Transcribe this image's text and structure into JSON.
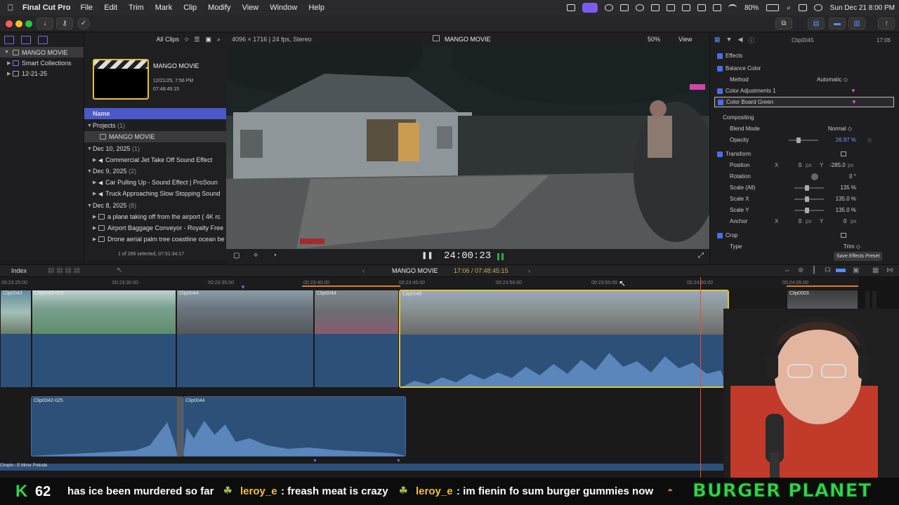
{
  "menubar": {
    "app_name": "Final Cut Pro",
    "items": [
      "File",
      "Edit",
      "Trim",
      "Mark",
      "Clip",
      "Modify",
      "View",
      "Window",
      "Help"
    ],
    "battery": "80%",
    "datetime": "Sun Dec 21  8:00 PM"
  },
  "library": {
    "items": [
      {
        "label": "MANGO MOVIE",
        "icon": "library-icon"
      },
      {
        "label": "Smart Collections",
        "icon": "folder-icon"
      },
      {
        "label": "12-21-25",
        "icon": "event-icon"
      }
    ]
  },
  "browser": {
    "filter": "All Clips",
    "project_title": "MANGO MOVIE",
    "project_date": "12/21/25, 7:56 PM",
    "project_duration": "07:48:45:15",
    "column_header": "Name",
    "rows": [
      {
        "type": "group",
        "label": "Projects",
        "count": "(1)"
      },
      {
        "type": "project",
        "label": "MANGO MOVIE"
      },
      {
        "type": "group",
        "label": "Dec 10, 2025",
        "count": "(1)"
      },
      {
        "type": "clip",
        "label": "Commercial Jet Take Off Sound Effect"
      },
      {
        "type": "group",
        "label": "Dec 9, 2025",
        "count": "(2)"
      },
      {
        "type": "clip",
        "label": "Car Pulling Up - Sound Effect  |  ProSoun"
      },
      {
        "type": "clip",
        "label": "Truck Approaching Slow Stopping Sound"
      },
      {
        "type": "group",
        "label": "Dec 8, 2025",
        "count": "(8)"
      },
      {
        "type": "clip",
        "label": "a plane taking off from the airport ( 4K rc"
      },
      {
        "type": "clip",
        "label": "Airport Baggage Conveyor - Royalty Free"
      },
      {
        "type": "clip",
        "label": "Drone aerial palm tree coastline ocean be"
      }
    ],
    "status": "1 of 289 selected, 07:51:34:17"
  },
  "viewer": {
    "format": "4096 × 1716 | 24 fps, Stereo",
    "title": "MANGO MOVIE",
    "zoom": "50%",
    "view_menu": "View",
    "timecode": "24:00:23"
  },
  "inspector": {
    "clip_name": "Clip0045",
    "duration": "17:06",
    "rows": [
      {
        "kind": "section",
        "label": "Effects",
        "checked": true
      },
      {
        "kind": "effect",
        "label": "Balance Color",
        "checked": true
      },
      {
        "kind": "param",
        "label": "Method",
        "value": "Automatic ◇"
      },
      {
        "kind": "effect",
        "label": "Color Adjustments 1",
        "checked": true
      },
      {
        "kind": "effect-selected",
        "label": "Color Board Green",
        "checked": true
      },
      {
        "kind": "subsection",
        "label": "Compositing"
      },
      {
        "kind": "param",
        "label": "Blend Mode",
        "value": "Normal ◇"
      },
      {
        "kind": "param-slider",
        "label": "Opacity",
        "value": "26.97  %",
        "level": 0.27
      },
      {
        "kind": "section",
        "label": "Transform",
        "checked": true
      },
      {
        "kind": "param-xy",
        "label": "Position",
        "x": "0",
        "xunit": "px",
        "y": "-285.0",
        "yunit": "px"
      },
      {
        "kind": "param",
        "label": "Rotation",
        "value": "0 °"
      },
      {
        "kind": "param-slider",
        "label": "Scale (All)",
        "value": "135  %",
        "level": 0.35
      },
      {
        "kind": "param-slider",
        "label": "Scale X",
        "value": "135.0  %",
        "level": 0.35
      },
      {
        "kind": "param-slider",
        "label": "Scale Y",
        "value": "135.0  %",
        "level": 0.35
      },
      {
        "kind": "param-xy",
        "label": "Anchor",
        "x": "0",
        "xunit": "px",
        "y": "0",
        "yunit": "px"
      },
      {
        "kind": "section",
        "label": "Crop",
        "checked": true
      },
      {
        "kind": "param",
        "label": "Type",
        "value": "Trim ◇"
      }
    ],
    "save_preset": "Save Effects Preset"
  },
  "timeline": {
    "index_label": "Index",
    "project_menu": "MANGO MOVIE",
    "timecode": "17:06 / 07:48:45:15",
    "ruler_labels": [
      "00:23:25:00",
      "00:23:30:00",
      "00:23:35:00",
      "00:23:40:00",
      "00:23:45:00",
      "00:23:50:00",
      "00:23:55:00",
      "00:24:00:00",
      "00:24:05:00"
    ],
    "clips": [
      {
        "name": "Clip0043",
        "selected": false
      },
      {
        "name": "Clip0042-025",
        "selected": false
      },
      {
        "name": "Clip0044",
        "selected": false
      },
      {
        "name": "Clip0044",
        "selected": false
      },
      {
        "name": "Clip0045",
        "selected": true
      },
      {
        "name": "Clip0003",
        "selected": false
      }
    ],
    "connected_audio": [
      {
        "name": "Clip0042-025"
      },
      {
        "name": "Clip0044"
      }
    ],
    "music_track": "Chopin - E Minor Prelude"
  },
  "chat": {
    "k_count": "62",
    "message_fragment": "has ice been murdered so far",
    "messages": [
      {
        "user": "leroy_e",
        "text": ": freash meat is crazy"
      },
      {
        "user": "leroy_e",
        "text": ": im fienin fo sum burger gummies now"
      }
    ],
    "brand": "BURGER PLANET"
  },
  "colors": {
    "accent": "#4a6de8",
    "selection_yellow": "#e0c43a",
    "audio_blue": "#2d5079",
    "playhead_red": "#e74c3c",
    "chat_user": "#f2c230",
    "brand_green": "#35d44a",
    "purple_icon": "#7c6be0"
  }
}
